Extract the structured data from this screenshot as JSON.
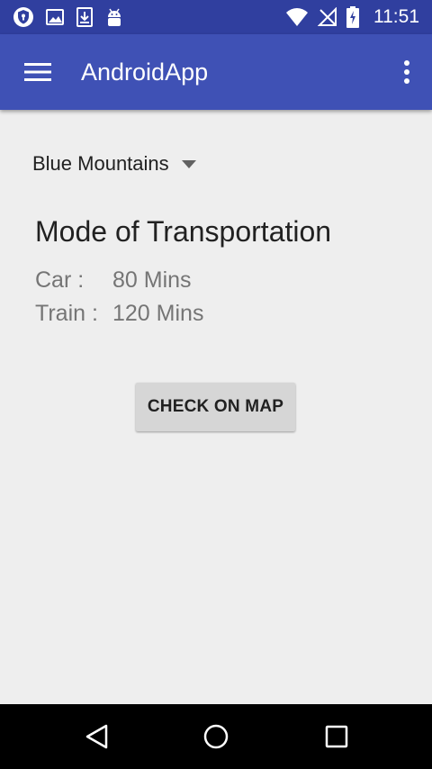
{
  "status_bar": {
    "time": "11:51",
    "left_icons": [
      "vpn-shield-icon",
      "image-icon",
      "download-icon",
      "android-icon"
    ],
    "right_icons": [
      "wifi-icon",
      "no-signal-icon",
      "battery-charging-icon"
    ]
  },
  "app_bar": {
    "title": "AndroidApp",
    "menu_icon": "hamburger-menu-icon",
    "overflow_icon": "more-vert-icon",
    "color": "#3f51b5",
    "status_color": "#303f9f"
  },
  "location_spinner": {
    "selected": "Blue Mountains"
  },
  "transport": {
    "title": "Mode of Transportation",
    "rows": [
      {
        "label": "Car :",
        "value": "80 Mins"
      },
      {
        "label": "Train :",
        "value": "120 Mins"
      }
    ]
  },
  "check_button": {
    "label": "CHECK ON MAP"
  },
  "nav_bar": {
    "buttons": [
      "back-icon",
      "home-icon",
      "recents-icon"
    ]
  }
}
